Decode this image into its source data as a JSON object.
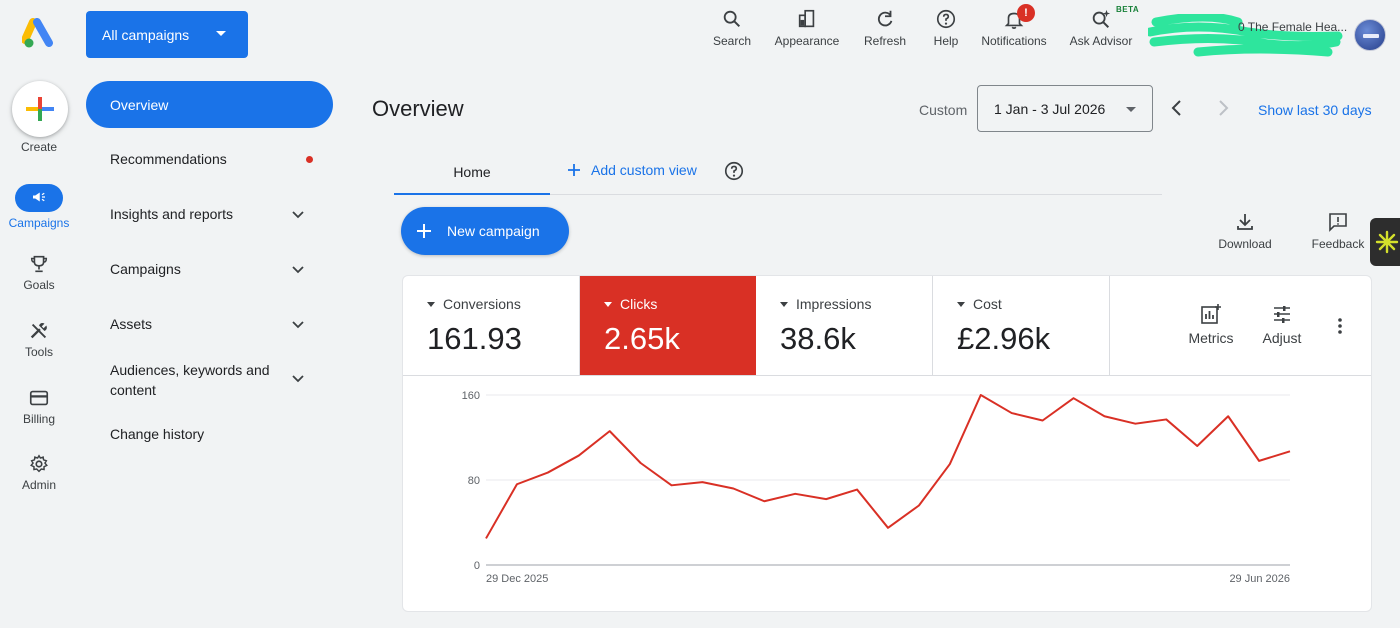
{
  "header": {
    "account_button": "All campaigns",
    "tools": [
      {
        "label": "Search",
        "icon": "search-icon"
      },
      {
        "label": "Appearance",
        "icon": "appearance-icon"
      },
      {
        "label": "Refresh",
        "icon": "refresh-icon"
      },
      {
        "label": "Help",
        "icon": "help-icon"
      },
      {
        "label": "Notifications",
        "icon": "bell-icon",
        "badge": "!"
      },
      {
        "label": "Ask Advisor",
        "icon": "advisor-icon",
        "tag": "BETA"
      }
    ],
    "account_name": "0 The Female Hea..."
  },
  "rail": {
    "items": [
      {
        "label": "Create"
      },
      {
        "label": "Campaigns"
      },
      {
        "label": "Goals"
      },
      {
        "label": "Tools"
      },
      {
        "label": "Billing"
      },
      {
        "label": "Admin"
      }
    ]
  },
  "nav": {
    "items": [
      {
        "label": "Overview"
      },
      {
        "label": "Recommendations"
      },
      {
        "label": "Insights and reports"
      },
      {
        "label": "Campaigns"
      },
      {
        "label": "Assets"
      },
      {
        "label": "Audiences, keywords and content"
      },
      {
        "label": "Change history"
      }
    ]
  },
  "main": {
    "title": "Overview",
    "date_label": "Custom",
    "date_range": "1 Jan - 3 Jul 2026",
    "show_last": "Show last 30 days",
    "tabs": [
      {
        "label": "Home"
      }
    ],
    "add_view": "Add custom view",
    "new_campaign": "New campaign",
    "download": "Download",
    "feedback": "Feedback"
  },
  "metrics": [
    {
      "label": "Conversions",
      "value": "161.93"
    },
    {
      "label": "Clicks",
      "value": "2.65k",
      "active": true
    },
    {
      "label": "Impressions",
      "value": "38.6k"
    },
    {
      "label": "Cost",
      "value": "£2.96k"
    }
  ],
  "metric_tools": {
    "metrics": "Metrics",
    "adjust": "Adjust"
  },
  "colors": {
    "accent": "#1a73e8",
    "clicks": "#d93025"
  },
  "chart_data": {
    "type": "line",
    "yticks": [
      "160",
      "80",
      "0"
    ],
    "ylim": [
      0,
      160
    ],
    "x_labels": [
      "29 Dec 2025",
      "29 Jun 2026"
    ],
    "series": [
      {
        "values": [
          25,
          76,
          87,
          103,
          126,
          96,
          75,
          78,
          72,
          60,
          67,
          62,
          71,
          35,
          56,
          95,
          160,
          143,
          136,
          157,
          140,
          133,
          137,
          112,
          140,
          98,
          107
        ]
      }
    ],
    "grid": true
  }
}
